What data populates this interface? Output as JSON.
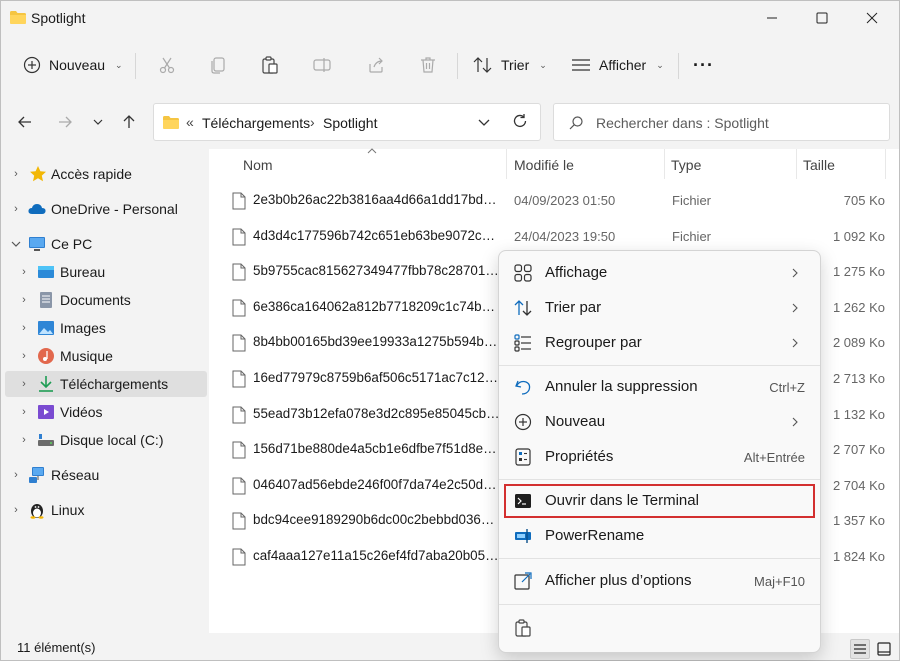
{
  "window": {
    "title": "Spotlight",
    "controls": {
      "minimize": "—",
      "maximize": "☐",
      "close": "✕"
    }
  },
  "commandbar": {
    "new_label": "Nouveau",
    "sort_label": "Trier",
    "view_label": "Afficher",
    "more_label": "···"
  },
  "address": {
    "overflow": "«",
    "crumbs": [
      "Téléchargements",
      "Spotlight"
    ],
    "separator": "›"
  },
  "search": {
    "placeholder": "Rechercher dans : Spotlight"
  },
  "navpane": {
    "items": [
      {
        "label": "Accès rapide",
        "icon": "star-icon"
      },
      {
        "label": "OneDrive - Personal",
        "icon": "cloud-icon"
      },
      {
        "label": "Ce PC",
        "icon": "pc-icon"
      },
      {
        "label": "Bureau",
        "icon": "desktop-icon"
      },
      {
        "label": "Documents",
        "icon": "documents-icon"
      },
      {
        "label": "Images",
        "icon": "pictures-icon"
      },
      {
        "label": "Musique",
        "icon": "music-icon"
      },
      {
        "label": "Téléchargements",
        "icon": "downloads-icon"
      },
      {
        "label": "Vidéos",
        "icon": "videos-icon"
      },
      {
        "label": "Disque local (C:)",
        "icon": "drive-icon"
      },
      {
        "label": "Réseau",
        "icon": "network-icon"
      },
      {
        "label": "Linux",
        "icon": "linux-icon"
      }
    ]
  },
  "filelist": {
    "headers": {
      "name": "Nom",
      "modified": "Modifié le",
      "type": "Type",
      "size": "Taille"
    },
    "rows": [
      {
        "name": "2e3b0b26ac22b3816aa4d66a1dd17bdd9...",
        "modified": "04/09/2023 01:50",
        "type": "Fichier",
        "size": "705 Ko"
      },
      {
        "name": "4d3d4c177596b742c651eb63be9072c28...",
        "modified": "24/04/2023 19:50",
        "type": "Fichier",
        "size": "1 092 Ko"
      },
      {
        "name": "5b9755cac815627349477fbb78c28701bf...",
        "modified": "",
        "type": "",
        "size": "1 275 Ko"
      },
      {
        "name": "6e386ca164062a812b7718209c1c74b90c...",
        "modified": "",
        "type": "",
        "size": "1 262 Ko"
      },
      {
        "name": "8b4bb00165bd39ee19933a1275b594b38...",
        "modified": "",
        "type": "",
        "size": "2 089 Ko"
      },
      {
        "name": "16ed77979c8759b6af506c5171ac7c127a...",
        "modified": "",
        "type": "",
        "size": "2 713 Ko"
      },
      {
        "name": "55ead73b12efa078e3d2c895e85045cb56...",
        "modified": "",
        "type": "",
        "size": "1 132 Ko"
      },
      {
        "name": "156d71be880de4a5cb1e6dfbe7f51d8e19...",
        "modified": "",
        "type": "",
        "size": "2 707 Ko"
      },
      {
        "name": "046407ad56ebde246f00f7da74e2c50d7b...",
        "modified": "",
        "type": "",
        "size": "2 704 Ko"
      },
      {
        "name": "bdc94cee9189290b6dc00c2bebbd036a7...",
        "modified": "",
        "type": "",
        "size": "1 357 Ko"
      },
      {
        "name": "caf4aaa127e11a15c26ef4fd7aba20b05ee...",
        "modified": "",
        "type": "",
        "size": "1 824 Ko"
      }
    ]
  },
  "contextmenu": {
    "items": [
      {
        "label": "Affichage",
        "shortcut": "",
        "submenu": true,
        "icon": "grid-icon"
      },
      {
        "label": "Trier par",
        "shortcut": "",
        "submenu": true,
        "icon": "sort-icon"
      },
      {
        "label": "Regrouper par",
        "shortcut": "",
        "submenu": true,
        "icon": "group-icon"
      },
      {
        "label": "Annuler la suppression",
        "shortcut": "Ctrl+Z",
        "submenu": false,
        "icon": "undo-icon"
      },
      {
        "label": "Nouveau",
        "shortcut": "",
        "submenu": true,
        "icon": "new-icon"
      },
      {
        "label": "Propriétés",
        "shortcut": "Alt+Entrée",
        "submenu": false,
        "icon": "properties-icon"
      },
      {
        "label": "Ouvrir dans le Terminal",
        "shortcut": "",
        "submenu": false,
        "icon": "terminal-icon",
        "highlighted": true
      },
      {
        "label": "PowerRename",
        "shortcut": "",
        "submenu": false,
        "icon": "powerrename-icon"
      },
      {
        "label": "Afficher plus d’options",
        "shortcut": "Maj+F10",
        "submenu": false,
        "icon": "more-options-icon"
      }
    ]
  },
  "statusbar": {
    "count": "11 élément(s)"
  },
  "colors": {
    "accent": "#0067c0",
    "highlight_border": "#d32f2f",
    "folder": "#f5c542"
  }
}
